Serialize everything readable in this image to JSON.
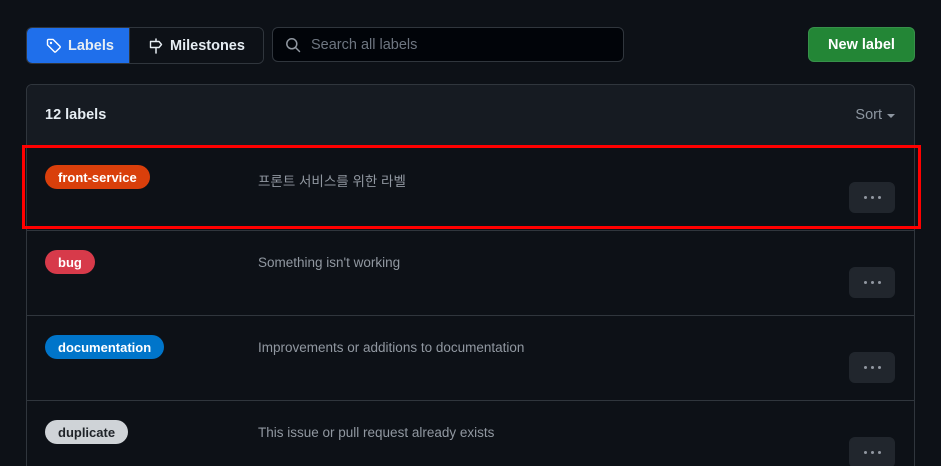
{
  "toolbar": {
    "labels_tab": "Labels",
    "milestones_tab": "Milestones",
    "search_placeholder": "Search all labels",
    "new_label_button": "New label"
  },
  "list": {
    "count_text": "12 labels",
    "sort_text": "Sort",
    "items": [
      {
        "name": "front-service",
        "description": "프론트 서비스를 위한 라벨",
        "color": "#d93f0b",
        "text_color": "#ffffff"
      },
      {
        "name": "bug",
        "description": "Something isn't working",
        "color": "#d73a4a",
        "text_color": "#ffffff"
      },
      {
        "name": "documentation",
        "description": "Improvements or additions to documentation",
        "color": "#0075ca",
        "text_color": "#ffffff"
      },
      {
        "name": "duplicate",
        "description": "This issue or pull request already exists",
        "color": "#cfd3d7",
        "text_color": "#1f2328"
      }
    ]
  },
  "colors": {
    "accent": "#1f6feb",
    "primary_button": "#238636",
    "highlight": "#ff0000"
  },
  "icons": {
    "labels_tab_icon": "tag-icon",
    "milestones_tab_icon": "milestone-icon",
    "search_icon": "search-icon",
    "row_menu_icon": "kebab-horizontal-icon"
  }
}
